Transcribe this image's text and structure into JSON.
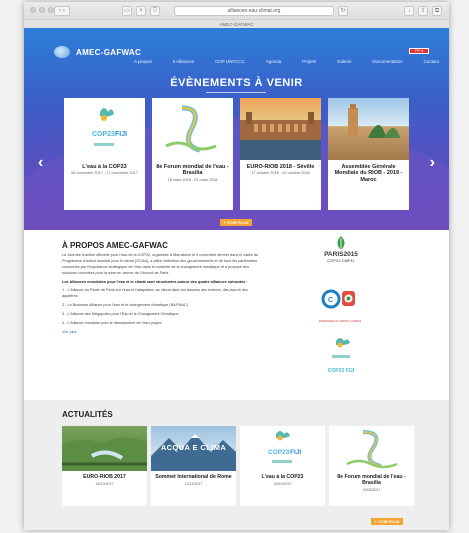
{
  "browser": {
    "url": "alliances-eau-climat.org",
    "tab_title": "AMEC-GAFWAC"
  },
  "site": {
    "logo_text": "AMEC-GAFWAC",
    "nav": [
      "A propos",
      "5 Alliances",
      "COP UNFCCC",
      "Agenda",
      "Projets",
      "Galerie",
      "Documentation",
      "Contact"
    ],
    "hero_title": "ÉVÈNEMENTS À VENIR",
    "events": [
      {
        "title": "L'eau à la COP23",
        "date": "06 novembre 2017 - 17 novembre 2017"
      },
      {
        "title": "8e Forum mondial de l'eau - Brasilia",
        "date": "18 mars 2018 - 23 mars 2018"
      },
      {
        "title": "EURO-RIOB 2018 - Séville",
        "date": "17 octobre 2018 - 20 octobre 2018"
      },
      {
        "title": "Assemblée Générale Mondiale du RIOB - 2019 - Maroc",
        "date": ""
      }
    ],
    "events_more": "+ VOIR PLUS",
    "about": {
      "title": "À PROPOS AMEC-GAFWAC",
      "p1": "La Journée d'action officielle pour l'eau de la COP22, organisée à Marrakech le 9 novembre dernier dans le cadre du Programme d'action mondial pour le climat (GCAA), a attiré l'attention des gouvernements et de tous les partenaires concernés par l'importance stratégique de l'eau dans le contexte de la changement climatique et a proposé des solutions concrètes pour la mise en œuvre de l'Accord de Paris.",
      "p2": "Les Alliances mondiales pour l'eau et le climat sont structurées autour des quatre alliances suivantes :",
      "list": [
        "1 - L'Alliance du Pacte de Paris sur l'eau et l'adaptation au climat dans les bassins des rivières, des lacs et des aquifères",
        "2 - Le Business Alliance pour l'eau et le changement climatique (BAFWAC)",
        "3 - L'Alliance des Mégapoles pour l'Eau et le Changement Climatique",
        "4 - L'Alliance mondiale pour le dessalement de l'eau propre"
      ],
      "read_more": "Voir plus",
      "paris_title": "PARIS2015",
      "paris_sub": "COP21·CMP11",
      "cop22_text": "MARRAKECH COP22 | CMP12",
      "cop23_text": "COP23 FIJI"
    },
    "news_title": "ACTUALITÉS",
    "news": [
      {
        "title": "EURO-RIOB 2017",
        "date": "16/10/2017"
      },
      {
        "title": "Sommet International de Rome",
        "date": "13/11/2017"
      },
      {
        "title": "L'eau à la COP23",
        "date": "18/10/2017"
      },
      {
        "title": "8e Forum mondial de l'eau - Brasilia",
        "date": "16/08/2017"
      }
    ],
    "news_more": "+ VOIR PLUS",
    "news_img2_text": "ACQUA E CLIMA"
  }
}
